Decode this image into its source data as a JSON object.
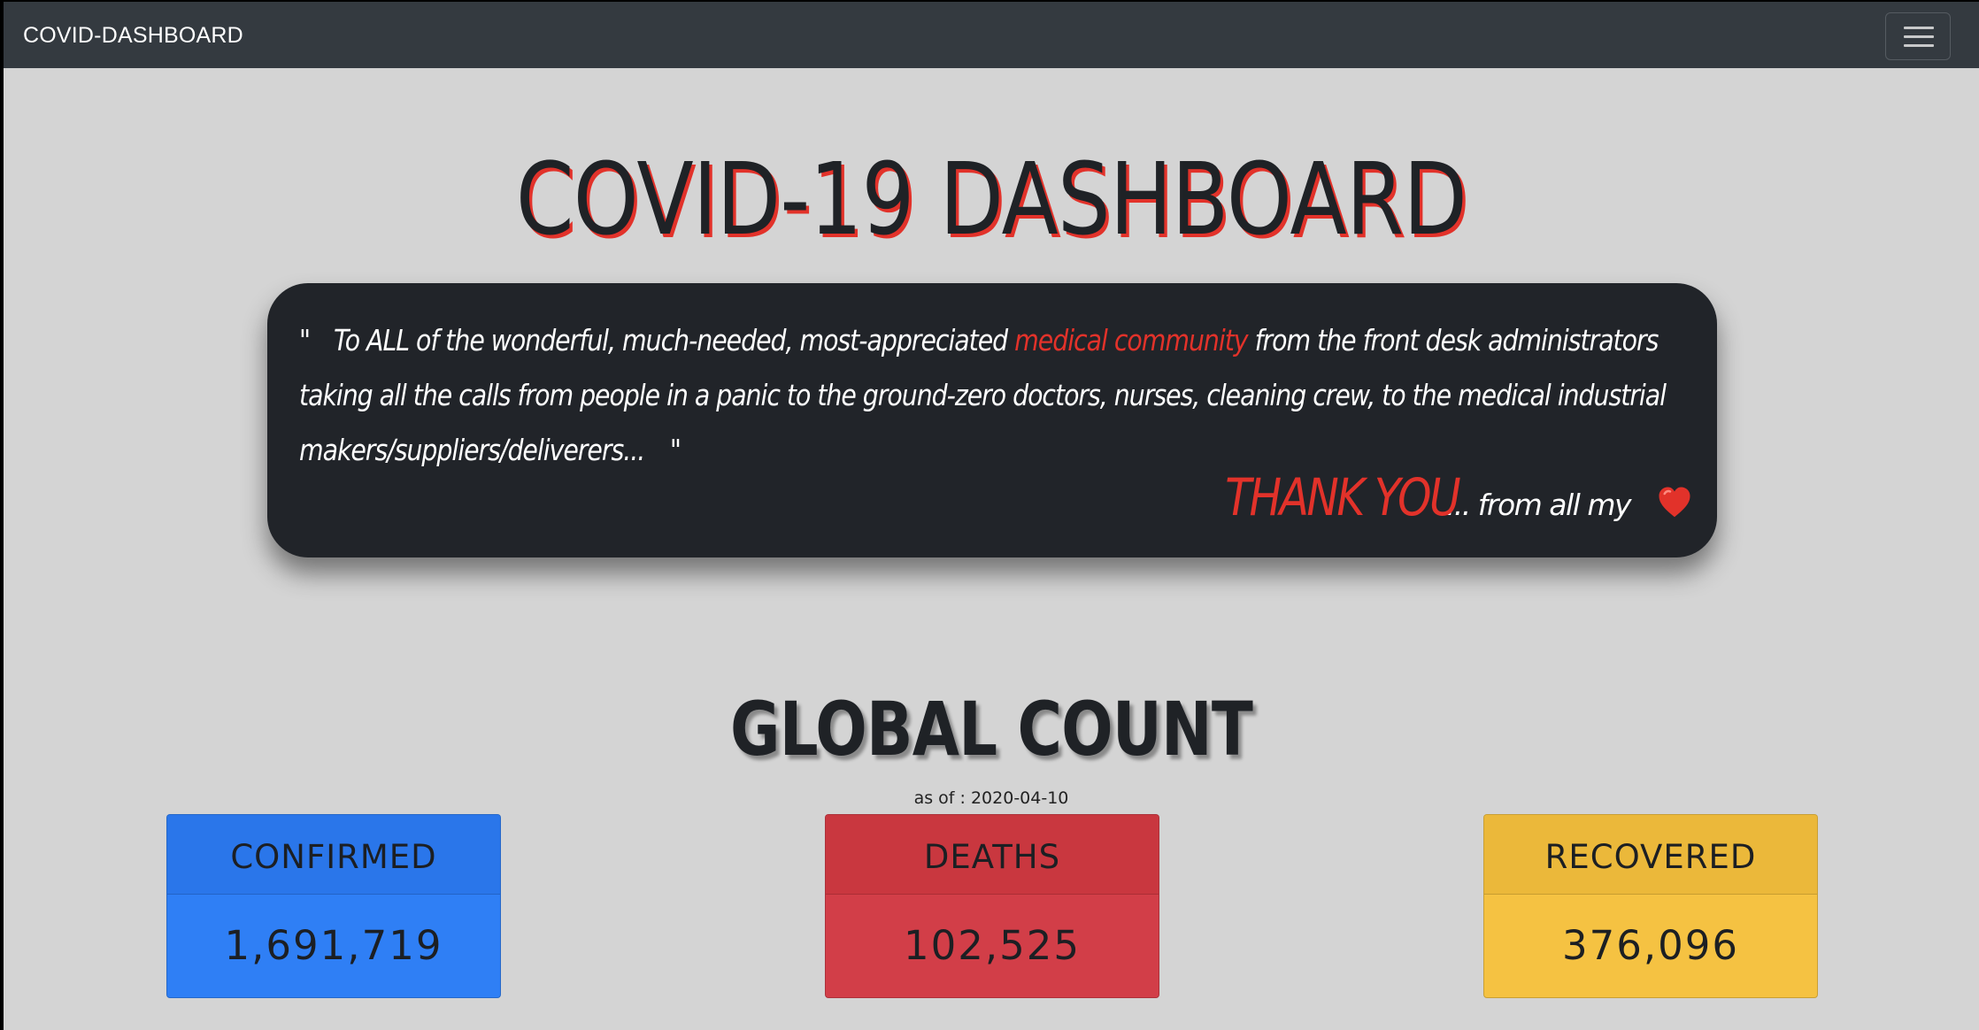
{
  "navbar": {
    "brand": "COVID-DASHBOARD",
    "toggler_icon": "hamburger-menu-icon"
  },
  "header": {
    "title": "COVID-19 DASHBOARD"
  },
  "quote": {
    "open_mark": "\"",
    "text_part1": "To ALL of the wonderful, much-needed, most-appreciated",
    "highlight": "medical community",
    "text_part2": "from the front desk administrators taking all the calls from people in a panic to the ground-zero doctors, nurses, cleaning crew, to the medical industrial makers/suppliers/deliverers...",
    "close_mark": "\"",
    "thanks": "THANK YOU",
    "thanks_suffix": "... from all my",
    "heart_icon": "heart-icon"
  },
  "global": {
    "title": "GLOBAL COUNT",
    "as_of": "as of : 2020-04-10"
  },
  "stats": {
    "confirmed": {
      "label": "CONFIRMED",
      "value": "1,691,719",
      "color": "#2f7ff5"
    },
    "deaths": {
      "label": "DEATHS",
      "value": "102,525",
      "color": "#d23e48"
    },
    "recovered": {
      "label": "RECOVERED",
      "value": "376,096",
      "color": "#f5c242"
    }
  },
  "colors": {
    "accent": "#e2322a",
    "navbar": "#343a40",
    "card": "#212429",
    "background": "#d4d4d4"
  }
}
